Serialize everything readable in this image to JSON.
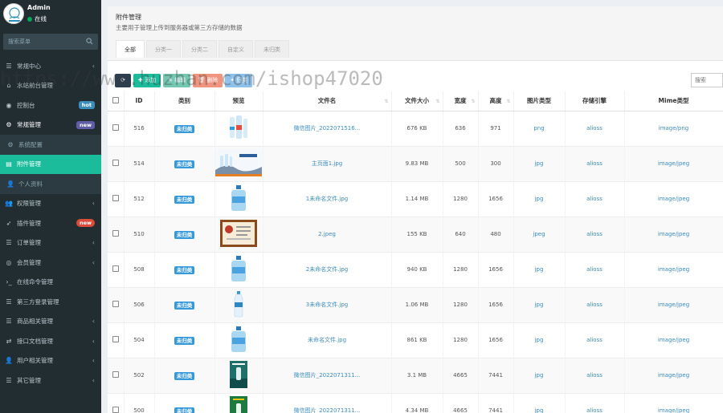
{
  "user": {
    "name": "Admin",
    "status": "在线"
  },
  "sidebar": {
    "search_placeholder": "搜索菜单",
    "items": [
      {
        "icon": "list-icon",
        "label": "常规中心",
        "arrow": "‹",
        "badge": ""
      },
      {
        "icon": "home-icon",
        "label": "水站前台管理",
        "arrow": "",
        "badge": ""
      },
      {
        "icon": "dashboard-icon",
        "label": "控制台",
        "arrow": "",
        "badge": "hot"
      },
      {
        "icon": "cogs-icon",
        "label": "常规管理",
        "arrow": "",
        "badge": "new"
      },
      {
        "icon": "cog-icon",
        "label": "系统配置",
        "arrow": "",
        "badge": ""
      },
      {
        "icon": "file-icon",
        "label": "附件管理",
        "arrow": "",
        "badge": ""
      },
      {
        "icon": "user-icon",
        "label": "个人资料",
        "arrow": "",
        "badge": ""
      },
      {
        "icon": "group-icon",
        "label": "权限管理",
        "arrow": "‹",
        "badge": ""
      },
      {
        "icon": "rocket-icon",
        "label": "插件管理",
        "arrow": "",
        "badge": "new"
      },
      {
        "icon": "list-icon",
        "label": "订单管理",
        "arrow": "‹",
        "badge": ""
      },
      {
        "icon": "user-circle-icon",
        "label": "会员管理",
        "arrow": "‹",
        "badge": ""
      },
      {
        "icon": "terminal-icon",
        "label": "在线命令管理",
        "arrow": "",
        "badge": ""
      },
      {
        "icon": "list-icon",
        "label": "第三方登录管理",
        "arrow": "",
        "badge": ""
      },
      {
        "icon": "list-icon",
        "label": "商品相关管理",
        "arrow": "‹",
        "badge": ""
      },
      {
        "icon": "share-icon",
        "label": "接口文档管理",
        "arrow": "‹",
        "badge": ""
      },
      {
        "icon": "user-icon",
        "label": "用户相关管理",
        "arrow": "‹",
        "badge": ""
      },
      {
        "icon": "list-icon",
        "label": "其它管理",
        "arrow": "‹",
        "badge": ""
      }
    ]
  },
  "panel": {
    "title": "附件管理",
    "subtitle": "主要用于管理上传到服务器或第三方存储的数据",
    "tabs": [
      "全部",
      "分类一",
      "分类二",
      "自定义",
      "未归类"
    ]
  },
  "toolbar": {
    "refresh": "⟳",
    "add": "✚ 添加",
    "edit": "✎ 编辑",
    "delete": "🗑 删除",
    "classify": "✦ 归类"
  },
  "search": {
    "placeholder": "搜索"
  },
  "watermark": "https://www.huzhan.com/ishop47020",
  "table": {
    "headers": [
      "ID",
      "类别",
      "预览",
      "文件名",
      "文件大小",
      "宽度",
      "高度",
      "图片类型",
      "存储引擎",
      "Mime类型"
    ],
    "rows": [
      {
        "id": "516",
        "category": "未归类",
        "thumb": "bottle-set",
        "filename": "微信图片_2022071516...",
        "size": "676 KB",
        "width": "636",
        "height": "971",
        "imgtype": "png",
        "storage": "alioss",
        "mime": "image/png"
      },
      {
        "id": "514",
        "category": "未归类",
        "thumb": "banner",
        "filename": "主页面1.jpg",
        "size": "9.83 MB",
        "width": "500",
        "height": "300",
        "imgtype": "jpg",
        "storage": "alioss",
        "mime": "image/jpeg"
      },
      {
        "id": "512",
        "category": "未归类",
        "thumb": "water-jug",
        "filename": "1未命名文件.jpg",
        "size": "1.14 MB",
        "width": "1280",
        "height": "1656",
        "imgtype": "jpg",
        "storage": "alioss",
        "mime": "image/jpeg"
      },
      {
        "id": "510",
        "category": "未归类",
        "thumb": "certificate",
        "filename": "2.jpeg",
        "size": "155 KB",
        "width": "640",
        "height": "480",
        "imgtype": "jpeg",
        "storage": "alioss",
        "mime": "image/jpeg"
      },
      {
        "id": "508",
        "category": "未归类",
        "thumb": "water-jug",
        "filename": "2未命名文件.jpg",
        "size": "940 KB",
        "width": "1280",
        "height": "1656",
        "imgtype": "jpg",
        "storage": "alioss",
        "mime": "image/jpeg"
      },
      {
        "id": "506",
        "category": "未归类",
        "thumb": "bottle",
        "filename": "3未命名文件.jpg",
        "size": "1.06 MB",
        "width": "1280",
        "height": "1656",
        "imgtype": "jpg",
        "storage": "alioss",
        "mime": "image/jpeg"
      },
      {
        "id": "504",
        "category": "未归类",
        "thumb": "water-jug",
        "filename": "未命名文件.jpg",
        "size": "861 KB",
        "width": "1280",
        "height": "1656",
        "imgtype": "jpg",
        "storage": "alioss",
        "mime": "image/jpeg"
      },
      {
        "id": "502",
        "category": "未归类",
        "thumb": "poster",
        "filename": "微信图片_2022071311...",
        "size": "3.1 MB",
        "width": "4665",
        "height": "7441",
        "imgtype": "jpg",
        "storage": "alioss",
        "mime": "image/jpeg"
      },
      {
        "id": "500",
        "category": "未归类",
        "thumb": "poster-green",
        "filename": "微信图片_2022071311...",
        "size": "4.34 MB",
        "width": "4665",
        "height": "7441",
        "imgtype": "jpg",
        "storage": "alioss",
        "mime": "image/jpeg"
      }
    ]
  }
}
